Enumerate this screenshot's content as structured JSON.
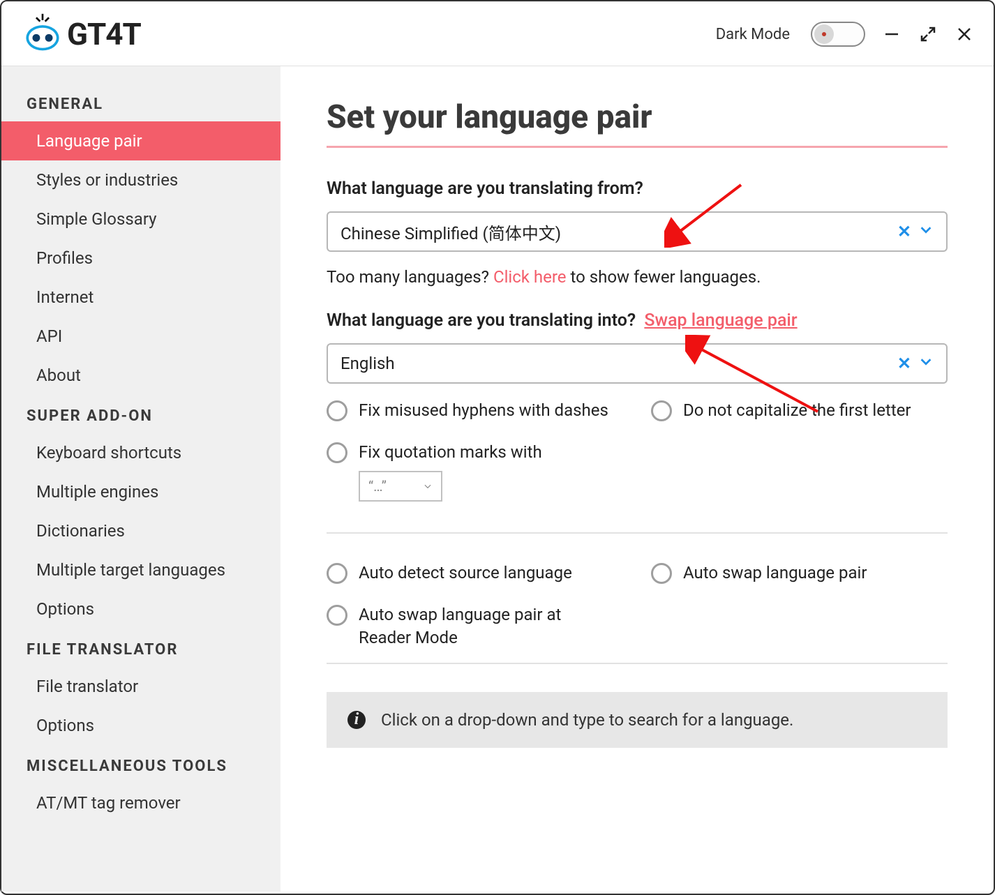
{
  "titlebar": {
    "brand": "GT4T",
    "dark_mode_label": "Dark Mode"
  },
  "sidebar": {
    "groups": [
      {
        "title": "General",
        "items": [
          {
            "label": "Language pair",
            "active": true
          },
          {
            "label": "Styles or industries"
          },
          {
            "label": "Simple Glossary"
          },
          {
            "label": "Profiles"
          },
          {
            "label": "Internet"
          },
          {
            "label": "API"
          },
          {
            "label": "About"
          }
        ]
      },
      {
        "title": "Super Add-on",
        "items": [
          {
            "label": "Keyboard shortcuts"
          },
          {
            "label": "Multiple engines"
          },
          {
            "label": "Dictionaries"
          },
          {
            "label": "Multiple target languages"
          },
          {
            "label": "Options"
          }
        ]
      },
      {
        "title": "File Translator",
        "items": [
          {
            "label": "File translator"
          },
          {
            "label": "Options"
          }
        ]
      },
      {
        "title": "Miscellaneous Tools",
        "items": [
          {
            "label": "AT/MT tag remover"
          }
        ]
      }
    ]
  },
  "main": {
    "page_title": "Set your language pair",
    "from": {
      "question": "What language are you translating from?",
      "value": "Chinese Simplified (简体中文)"
    },
    "helper": {
      "pre": "Too many languages? ",
      "link": "Click here",
      "post": " to show fewer languages."
    },
    "into": {
      "question": "What language are you translating into?",
      "swap_link": "Swap language pair",
      "value": "English"
    },
    "options_block1": {
      "fix_hyphens": "Fix misused hyphens with dashes",
      "no_capitalize": "Do not capitalize the first letter",
      "fix_quotes": "Fix quotation marks with",
      "quote_value": "“…”"
    },
    "options_block2": {
      "auto_detect": "Auto detect source language",
      "auto_swap": "Auto swap language pair",
      "auto_swap_reader": "Auto swap language pair at Reader Mode"
    },
    "info_banner": "Click on a drop-down and type to search for a language."
  }
}
